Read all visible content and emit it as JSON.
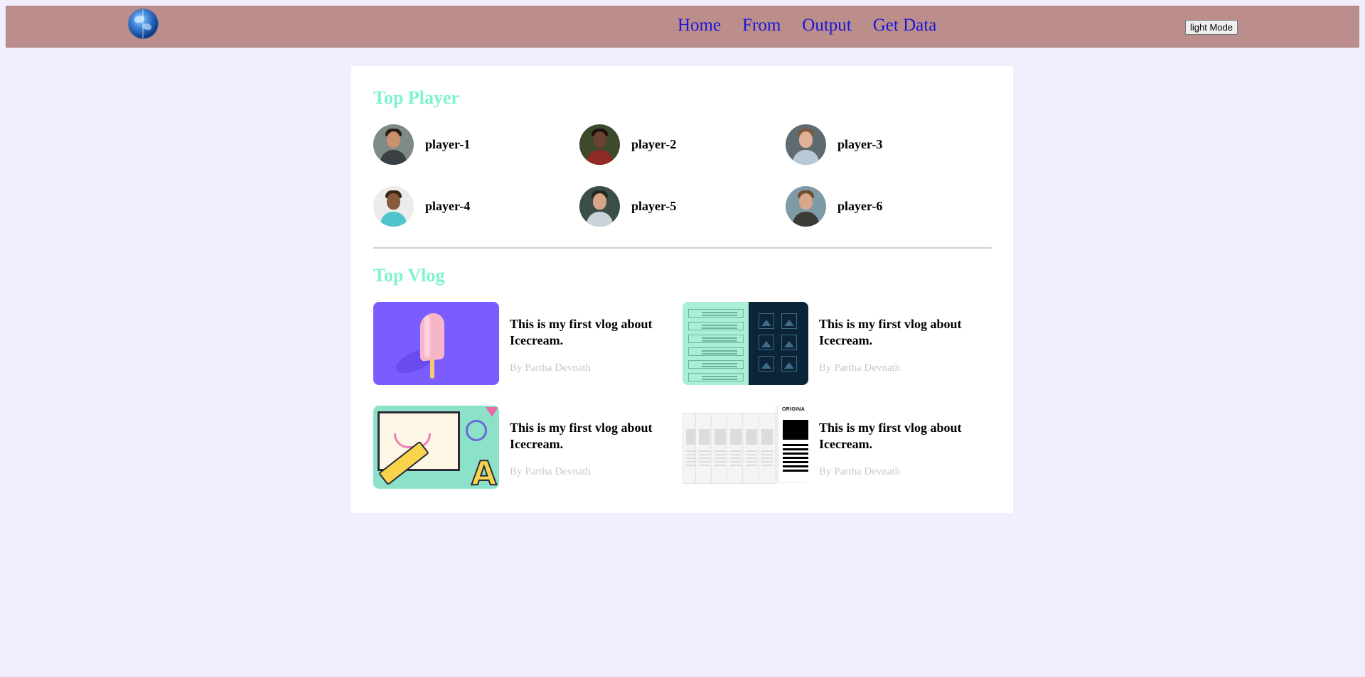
{
  "navbar": {
    "logo": "globe-logo",
    "links": [
      "Home",
      "From",
      "Output",
      "Get Data"
    ],
    "mode_button": "light Mode"
  },
  "players_section": {
    "title": "Top Player",
    "players": [
      "player-1",
      "player-2",
      "player-3",
      "player-4",
      "player-5",
      "player-6"
    ]
  },
  "vlog_section": {
    "title": "Top Vlog",
    "vlogs": [
      {
        "title": "This is my first vlog about Icecream.",
        "author": "By Partha Devnath"
      },
      {
        "title": "This is my first vlog about Icecream.",
        "author": "By Partha Devnath"
      },
      {
        "title": "This is my first vlog about Icecream.",
        "author": "By Partha Devnath"
      },
      {
        "title": "This is my first vlog about Icecream.",
        "author": "By Partha Devnath"
      }
    ]
  },
  "thumbnail_text": {
    "original": "ORIGINA"
  },
  "colors": {
    "page_bg": "#f1effd",
    "navbar_bg": "#bb8d8b",
    "link": "#1a16d9",
    "section_title": "#7ff2d0",
    "author": "#c9c9c9"
  }
}
